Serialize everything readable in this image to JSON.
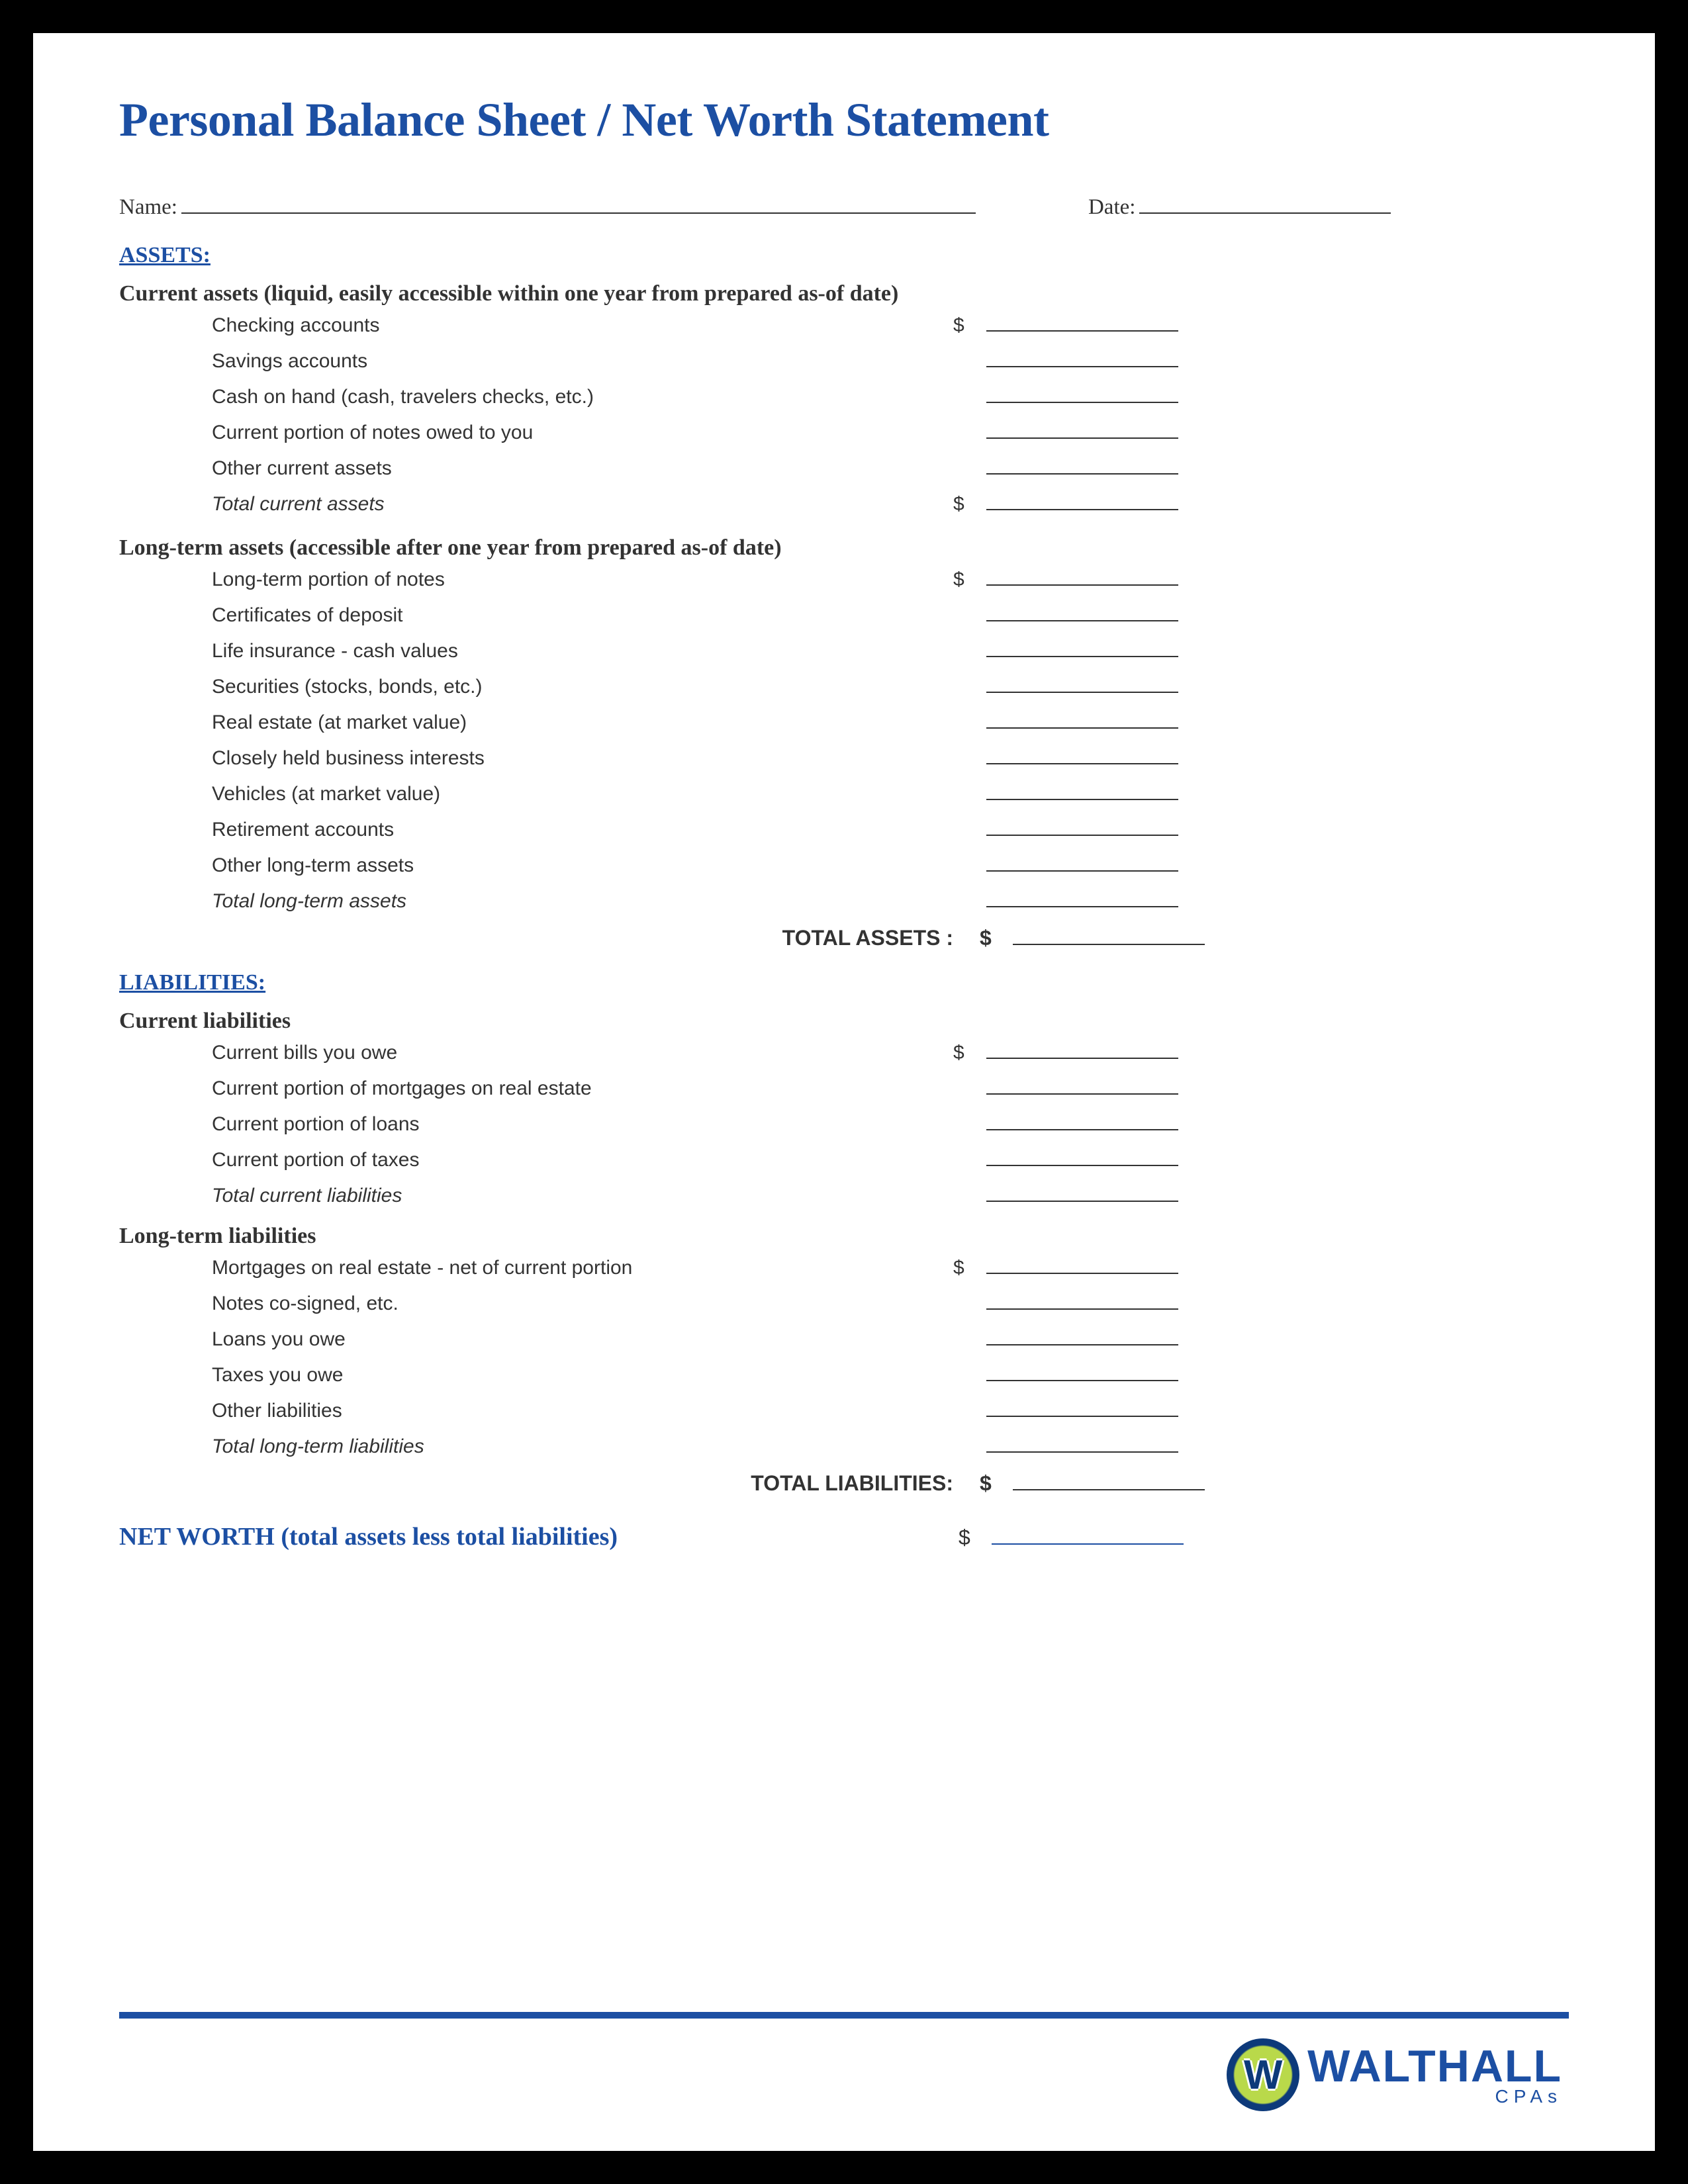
{
  "title": "Personal Balance Sheet / Net Worth Statement",
  "header": {
    "name_label": "Name:",
    "date_label": "Date:"
  },
  "assets": {
    "heading": "ASSETS:",
    "current": {
      "heading": "Current assets (liquid, easily accessible within one year from prepared as-of date)",
      "items": [
        "Checking accounts",
        "Savings accounts",
        "Cash on hand (cash, travelers checks, etc.)",
        "Current portion of notes owed to you",
        "Other current assets"
      ],
      "total_label": "Total current assets"
    },
    "longterm": {
      "heading": "Long-term assets (accessible after one year from prepared as-of date)",
      "items": [
        "Long-term portion of notes",
        "Certificates of deposit",
        "Life insurance - cash values",
        "Securities (stocks, bonds, etc.)",
        "Real estate (at market value)",
        "Closely held business interests",
        "Vehicles (at market value)",
        "Retirement accounts",
        "Other long-term assets"
      ],
      "total_label": "Total long-term assets"
    },
    "grand_total_label": "TOTAL ASSETS :"
  },
  "liabilities": {
    "heading": "LIABILITIES:",
    "current": {
      "heading": "Current liabilities",
      "items": [
        "Current bills you owe",
        "Current portion of mortgages on real estate",
        "Current portion of loans",
        "Current portion of taxes"
      ],
      "total_label": "Total current liabilities"
    },
    "longterm": {
      "heading": "Long-term liabilities",
      "items": [
        "Mortgages on real estate - net of current portion",
        "Notes co-signed, etc.",
        "Loans you owe",
        "Taxes you owe",
        "Other liabilities"
      ],
      "total_label": "Total long-term liabilities"
    },
    "grand_total_label": "TOTAL LIABILITIES:"
  },
  "networth_label": "NET WORTH (total assets less total liabilities)",
  "dollar_sign": "$",
  "logo": {
    "main": "WALTHALL",
    "sub": "CPAs"
  }
}
